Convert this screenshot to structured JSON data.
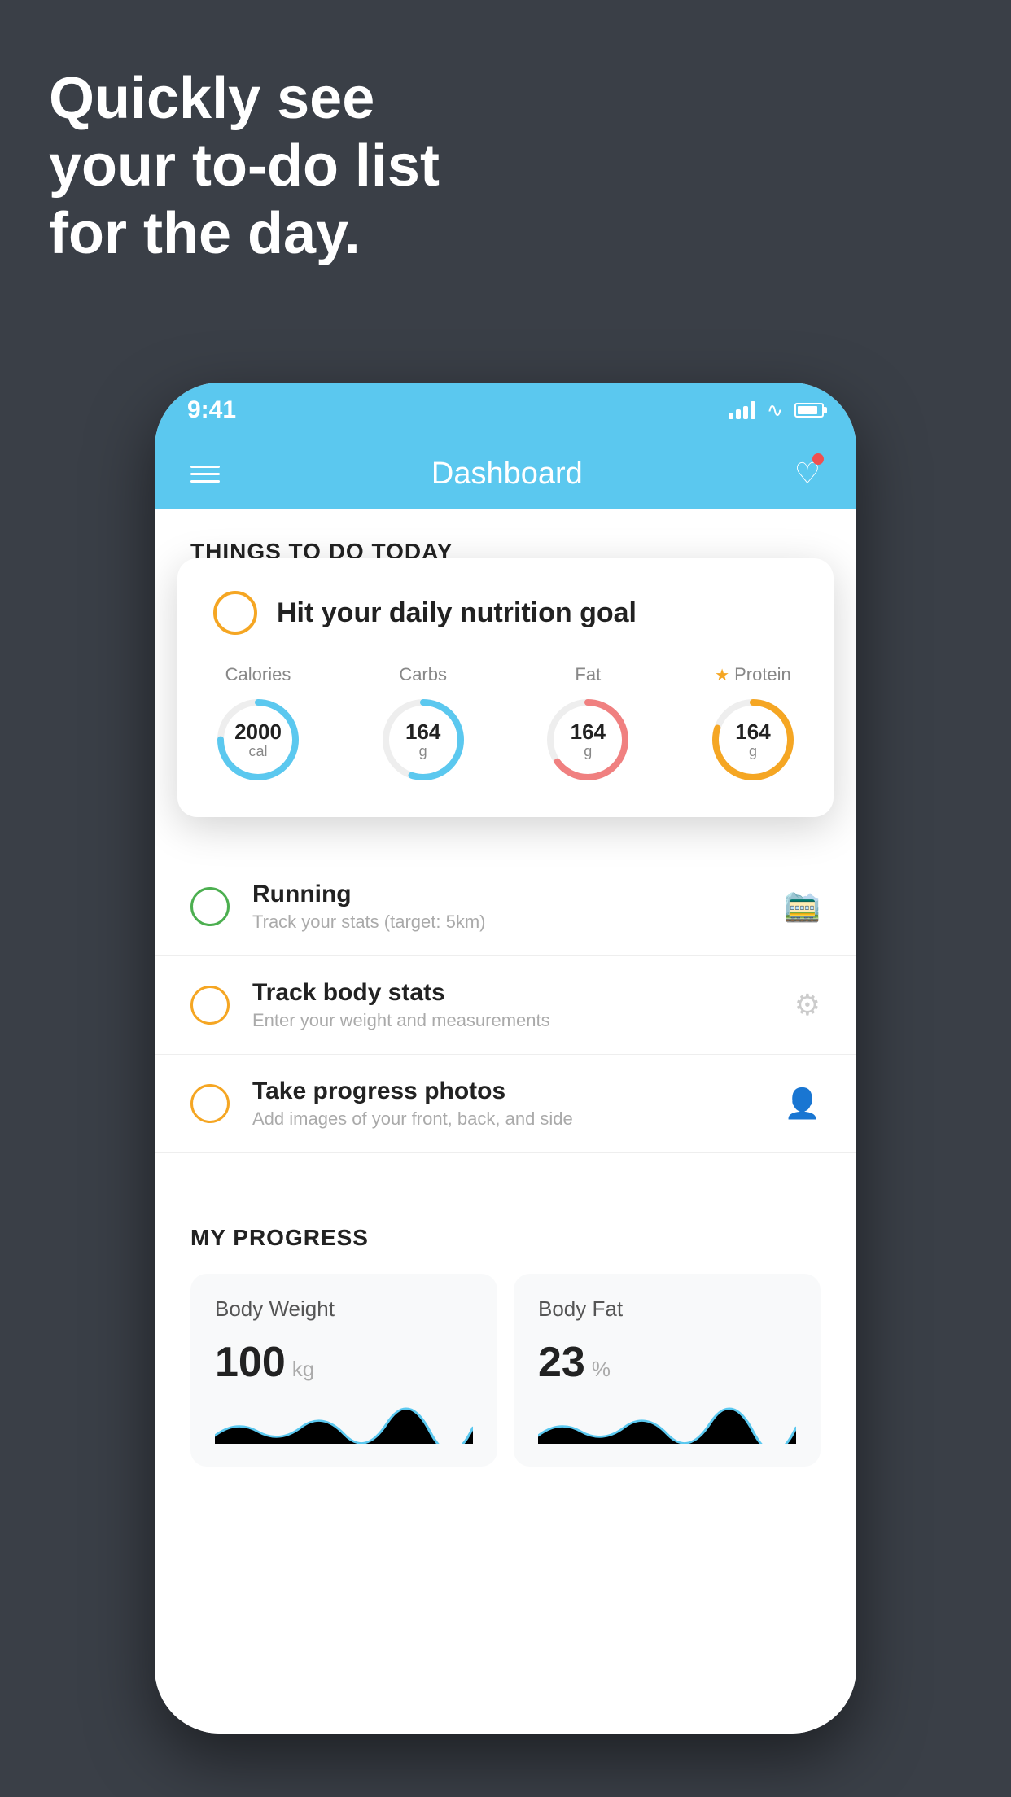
{
  "hero": {
    "line1": "Quickly see",
    "line2": "your to-do list",
    "line3": "for the day."
  },
  "status_bar": {
    "time": "9:41"
  },
  "header": {
    "title": "Dashboard"
  },
  "things_section": {
    "label": "THINGS TO DO TODAY"
  },
  "nutrition_card": {
    "title": "Hit your daily nutrition goal",
    "items": [
      {
        "label": "Calories",
        "value": "2000",
        "unit": "cal",
        "color": "#5bc8ef",
        "track": 75
      },
      {
        "label": "Carbs",
        "value": "164",
        "unit": "g",
        "color": "#5bc8ef",
        "track": 55
      },
      {
        "label": "Fat",
        "value": "164",
        "unit": "g",
        "color": "#f08080",
        "track": 65
      },
      {
        "label": "Protein",
        "value": "164",
        "unit": "g",
        "color": "#f5a623",
        "track": 80,
        "starred": true
      }
    ]
  },
  "todo_items": [
    {
      "title": "Running",
      "subtitle": "Track your stats (target: 5km)",
      "circle_color": "green",
      "icon": "shoe"
    },
    {
      "title": "Track body stats",
      "subtitle": "Enter your weight and measurements",
      "circle_color": "yellow",
      "icon": "scale"
    },
    {
      "title": "Take progress photos",
      "subtitle": "Add images of your front, back, and side",
      "circle_color": "yellow",
      "icon": "person"
    }
  ],
  "progress": {
    "label": "MY PROGRESS",
    "cards": [
      {
        "title": "Body Weight",
        "value": "100",
        "unit": "kg"
      },
      {
        "title": "Body Fat",
        "value": "23",
        "unit": "%"
      }
    ]
  }
}
